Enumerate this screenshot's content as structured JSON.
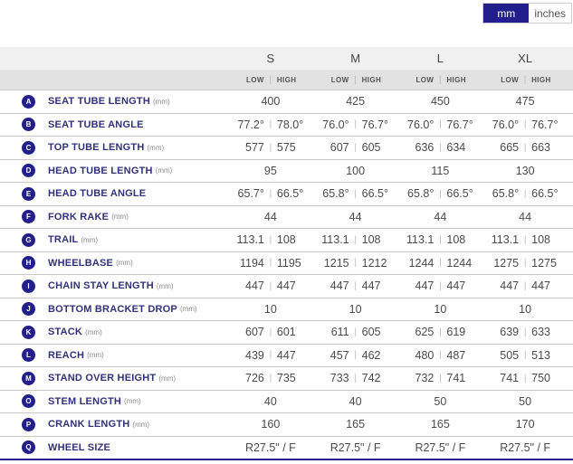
{
  "unit_toggle": {
    "options": [
      {
        "label": "mm",
        "active": true
      },
      {
        "label": "inches",
        "active": false
      }
    ]
  },
  "table": {
    "size_headers": [
      "S",
      "M",
      "L",
      "XL"
    ],
    "position_headers": {
      "low": "LOW",
      "high": "HIGH"
    },
    "rows": [
      {
        "letter": "A",
        "label": "SEAT TUBE LENGTH",
        "unit": "(mm)",
        "cells": [
          [
            "400"
          ],
          [
            "425"
          ],
          [
            "450"
          ],
          [
            "475"
          ]
        ]
      },
      {
        "letter": "B",
        "label": "SEAT TUBE ANGLE",
        "unit": "",
        "cells": [
          [
            "77.2°",
            "78.0°"
          ],
          [
            "76.0°",
            "76.7°"
          ],
          [
            "76.0°",
            "76.7°"
          ],
          [
            "76.0°",
            "76.7°"
          ]
        ]
      },
      {
        "letter": "C",
        "label": "TOP TUBE LENGTH",
        "unit": "(mm)",
        "cells": [
          [
            "577",
            "575"
          ],
          [
            "607",
            "605"
          ],
          [
            "636",
            "634"
          ],
          [
            "665",
            "663"
          ]
        ]
      },
      {
        "letter": "D",
        "label": "HEAD TUBE LENGTH",
        "unit": "(mm)",
        "cells": [
          [
            "95"
          ],
          [
            "100"
          ],
          [
            "115"
          ],
          [
            "130"
          ]
        ]
      },
      {
        "letter": "E",
        "label": "HEAD TUBE ANGLE",
        "unit": "",
        "cells": [
          [
            "65.7°",
            "66.5°"
          ],
          [
            "65.8°",
            "66.5°"
          ],
          [
            "65.8°",
            "66.5°"
          ],
          [
            "65.8°",
            "66.5°"
          ]
        ]
      },
      {
        "letter": "F",
        "label": "FORK RAKE",
        "unit": "(mm)",
        "cells": [
          [
            "44"
          ],
          [
            "44"
          ],
          [
            "44"
          ],
          [
            "44"
          ]
        ]
      },
      {
        "letter": "G",
        "label": "TRAIL",
        "unit": "(mm)",
        "cells": [
          [
            "113.1",
            "108"
          ],
          [
            "113.1",
            "108"
          ],
          [
            "113.1",
            "108"
          ],
          [
            "113.1",
            "108"
          ]
        ]
      },
      {
        "letter": "H",
        "label": "WHEELBASE",
        "unit": "(mm)",
        "cells": [
          [
            "1194",
            "1195"
          ],
          [
            "1215",
            "1212"
          ],
          [
            "1244",
            "1244"
          ],
          [
            "1275",
            "1275"
          ]
        ]
      },
      {
        "letter": "I",
        "label": "CHAIN STAY LENGTH",
        "unit": "(mm)",
        "cells": [
          [
            "447",
            "447"
          ],
          [
            "447",
            "447"
          ],
          [
            "447",
            "447"
          ],
          [
            "447",
            "447"
          ]
        ]
      },
      {
        "letter": "J",
        "label": "BOTTOM BRACKET DROP",
        "unit": "(mm)",
        "cells": [
          [
            "10"
          ],
          [
            "10"
          ],
          [
            "10"
          ],
          [
            "10"
          ]
        ]
      },
      {
        "letter": "K",
        "label": "STACK",
        "unit": "(mm)",
        "cells": [
          [
            "607",
            "601"
          ],
          [
            "611",
            "605"
          ],
          [
            "625",
            "619"
          ],
          [
            "639",
            "633"
          ]
        ]
      },
      {
        "letter": "L",
        "label": "REACH",
        "unit": "(mm)",
        "cells": [
          [
            "439",
            "447"
          ],
          [
            "457",
            "462"
          ],
          [
            "480",
            "487"
          ],
          [
            "505",
            "513"
          ]
        ]
      },
      {
        "letter": "M",
        "label": "STAND OVER HEIGHT",
        "unit": "(mm)",
        "cells": [
          [
            "726",
            "735"
          ],
          [
            "733",
            "742"
          ],
          [
            "732",
            "741"
          ],
          [
            "741",
            "750"
          ]
        ]
      },
      {
        "letter": "O",
        "label": "STEM LENGTH",
        "unit": "(mm)",
        "cells": [
          [
            "40"
          ],
          [
            "40"
          ],
          [
            "50"
          ],
          [
            "50"
          ]
        ]
      },
      {
        "letter": "P",
        "label": "CRANK LENGTH",
        "unit": "(mm)",
        "cells": [
          [
            "160"
          ],
          [
            "165"
          ],
          [
            "165"
          ],
          [
            "170"
          ]
        ]
      },
      {
        "letter": "Q",
        "label": "WHEEL SIZE",
        "unit": "",
        "cells": [
          [
            "R27.5\" / F"
          ],
          [
            "R27.5\" / F"
          ],
          [
            "R27.5\" / F"
          ],
          [
            "R27.5\" / F"
          ]
        ]
      }
    ]
  },
  "colors": {
    "accent_navy": "#221e8c",
    "header_bg": "#f0f0f0",
    "subheader_bg": "#e2e2e2",
    "row_divider": "#c9c9c9",
    "value_text": "#4a4a4a",
    "label_text": "#32327a"
  }
}
